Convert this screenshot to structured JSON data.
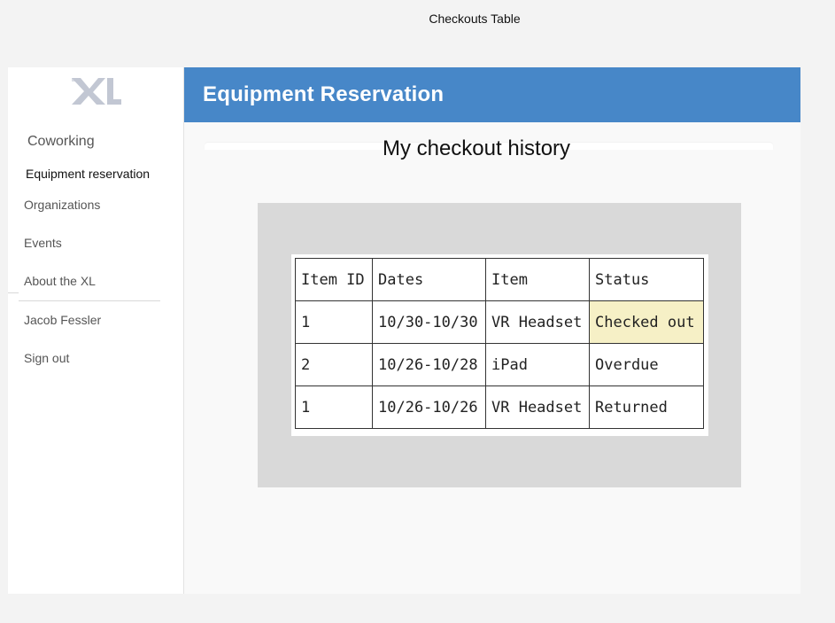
{
  "canvas": {
    "title": "Checkouts Table"
  },
  "sidebar": {
    "logo_text": "XL",
    "items": [
      {
        "label": "Coworking"
      },
      {
        "label": "Equipment reservation"
      },
      {
        "label": "Organizations"
      },
      {
        "label": "Events"
      },
      {
        "label": "About the XL"
      },
      {
        "label": "Jacob Fessler"
      },
      {
        "label": "Sign out"
      }
    ]
  },
  "header": {
    "title": "Equipment Reservation"
  },
  "main": {
    "section_title": "My checkout history",
    "table": {
      "columns": [
        "Item ID",
        "Dates",
        "Item",
        "Status"
      ],
      "rows": [
        {
          "item_id": "1",
          "dates": "10/30-10/30",
          "item": "VR Headset",
          "status": "Checked out"
        },
        {
          "item_id": "2",
          "dates": "10/26-10/28",
          "item": "iPad",
          "status": "Overdue"
        },
        {
          "item_id": "1",
          "dates": "10/26-10/26",
          "item": "VR Headset",
          "status": "Returned"
        }
      ]
    }
  },
  "colors": {
    "header": "#4787c8",
    "highlight": "#f6f0c6",
    "panel": "#d9d9d9",
    "logo": "#c2c7d3"
  }
}
